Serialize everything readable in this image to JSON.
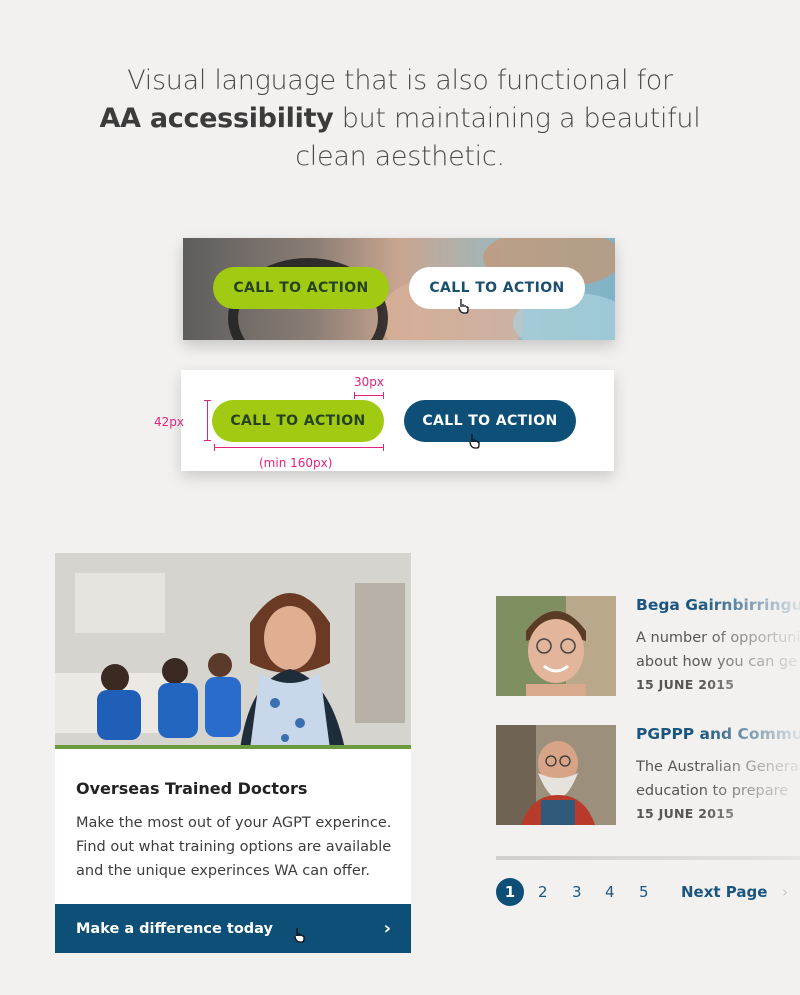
{
  "headline": {
    "line1": "Visual language that is also functional for",
    "bold": "AA accessibility",
    "line2_rest": " but maintaining a beautiful",
    "line3": "clean aesthetic."
  },
  "photo_buttons": {
    "green_label": "CALL TO ACTION",
    "white_label": "CALL TO ACTION"
  },
  "spec_buttons": {
    "green_label": "CALL TO ACTION",
    "navy_label": "CALL TO ACTION",
    "height_label": "42px",
    "padding_label": "30px",
    "width_label": "(min 160px)"
  },
  "card": {
    "title": "Overseas Trained Doctors",
    "text": "Make the most out of your AGPT experince. Find out what training options are available and the unique experinces WA can offer.",
    "cta": "Make a difference today",
    "chevron": "›"
  },
  "news": [
    {
      "title": "Bega Gairnbirringu",
      "excerpt_line1": "A number of opportuni",
      "excerpt_line2": "about how you can ge",
      "date": "15 JUNE 2015"
    },
    {
      "title": "PGPPP and Commu",
      "excerpt_line1": "The Australian Genera",
      "excerpt_line2": "education to prepare",
      "date": "15 JUNE 2015"
    }
  ],
  "pagination": {
    "pages": [
      "1",
      "2",
      "3",
      "4",
      "5"
    ],
    "active": "1",
    "next": "Next Page",
    "chevron": "›"
  },
  "colors": {
    "brand_navy": "#0e4f78",
    "brand_green": "#a1cb12",
    "annotation_pink": "#e0237e",
    "background": "#f2f1ef"
  }
}
